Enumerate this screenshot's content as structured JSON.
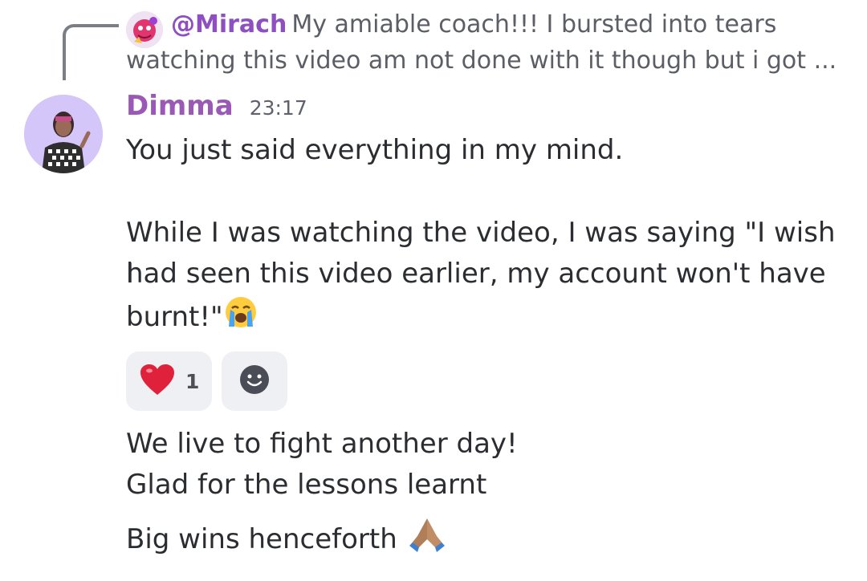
{
  "reply": {
    "author": "@Mirach",
    "text": "My amiable coach!!! I bursted into tears watching this video am not done with it though but i got ..."
  },
  "message": {
    "author": "Dimma",
    "timestamp": "23:17",
    "lines": [
      "You just said everything in my mind.",
      "While I was watching the video, I was saying \"I wish I",
      "had seen this video earlier, my account won't have",
      "burnt!\""
    ],
    "emoji_crying": "loudly-crying-face-emoji"
  },
  "reactions": [
    {
      "emoji": "red-heart-emoji",
      "count": "1"
    },
    {
      "emoji": "add-reaction-icon"
    }
  ],
  "followups": [
    "We live to fight another day!",
    "Glad for the lessons learnt",
    "Big wins henceforth"
  ],
  "colors": {
    "author_name": "#9b59b6",
    "reply_author": "#8e4fc0",
    "avatar_bg": "#d4c6f8",
    "reaction_bg": "#eef0f3",
    "reply_line": "#7b7e85"
  }
}
